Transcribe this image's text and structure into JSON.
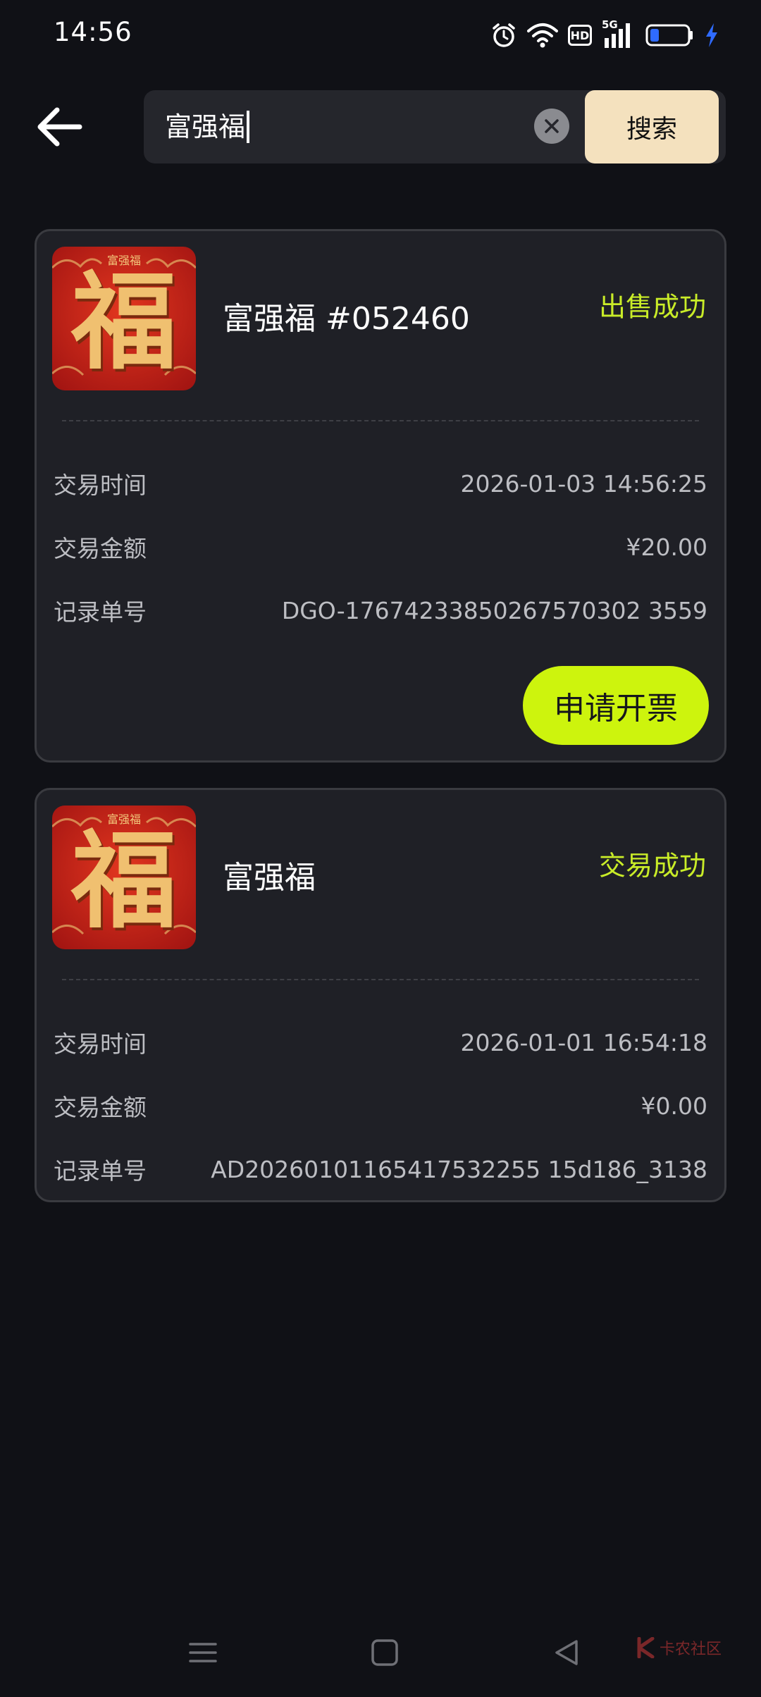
{
  "status_bar": {
    "time": "14:56",
    "signal_label": "5G",
    "hd_label": "HD"
  },
  "search": {
    "value": "富强福",
    "button_label": "搜索"
  },
  "records": [
    {
      "title": "富强福 #052460",
      "status": "出售成功",
      "rows": [
        {
          "label": "交易时间",
          "value": "2026-01-03 14:56:25"
        },
        {
          "label": "交易金额",
          "value": "¥20.00"
        },
        {
          "label": "记录单号",
          "value": "DGO-17674233850267570302 3559"
        }
      ],
      "action_label": "申请开票"
    },
    {
      "title": "富强福",
      "status": "交易成功",
      "rows": [
        {
          "label": "交易时间",
          "value": "2026-01-01 16:54:18"
        },
        {
          "label": "交易金额",
          "value": "¥0.00"
        },
        {
          "label": "记录单号",
          "value": "AD20260101165417532255 15d186_3138"
        }
      ]
    }
  ],
  "thumbnail": {
    "caption": "富强福",
    "glyph": "福"
  },
  "colors": {
    "accent": "#cdf40d",
    "status": "#c9ec28",
    "search_button": "#f4e1be",
    "card_bg": "#1f2026",
    "page_bg": "#101116"
  },
  "watermark": "卡农社区"
}
